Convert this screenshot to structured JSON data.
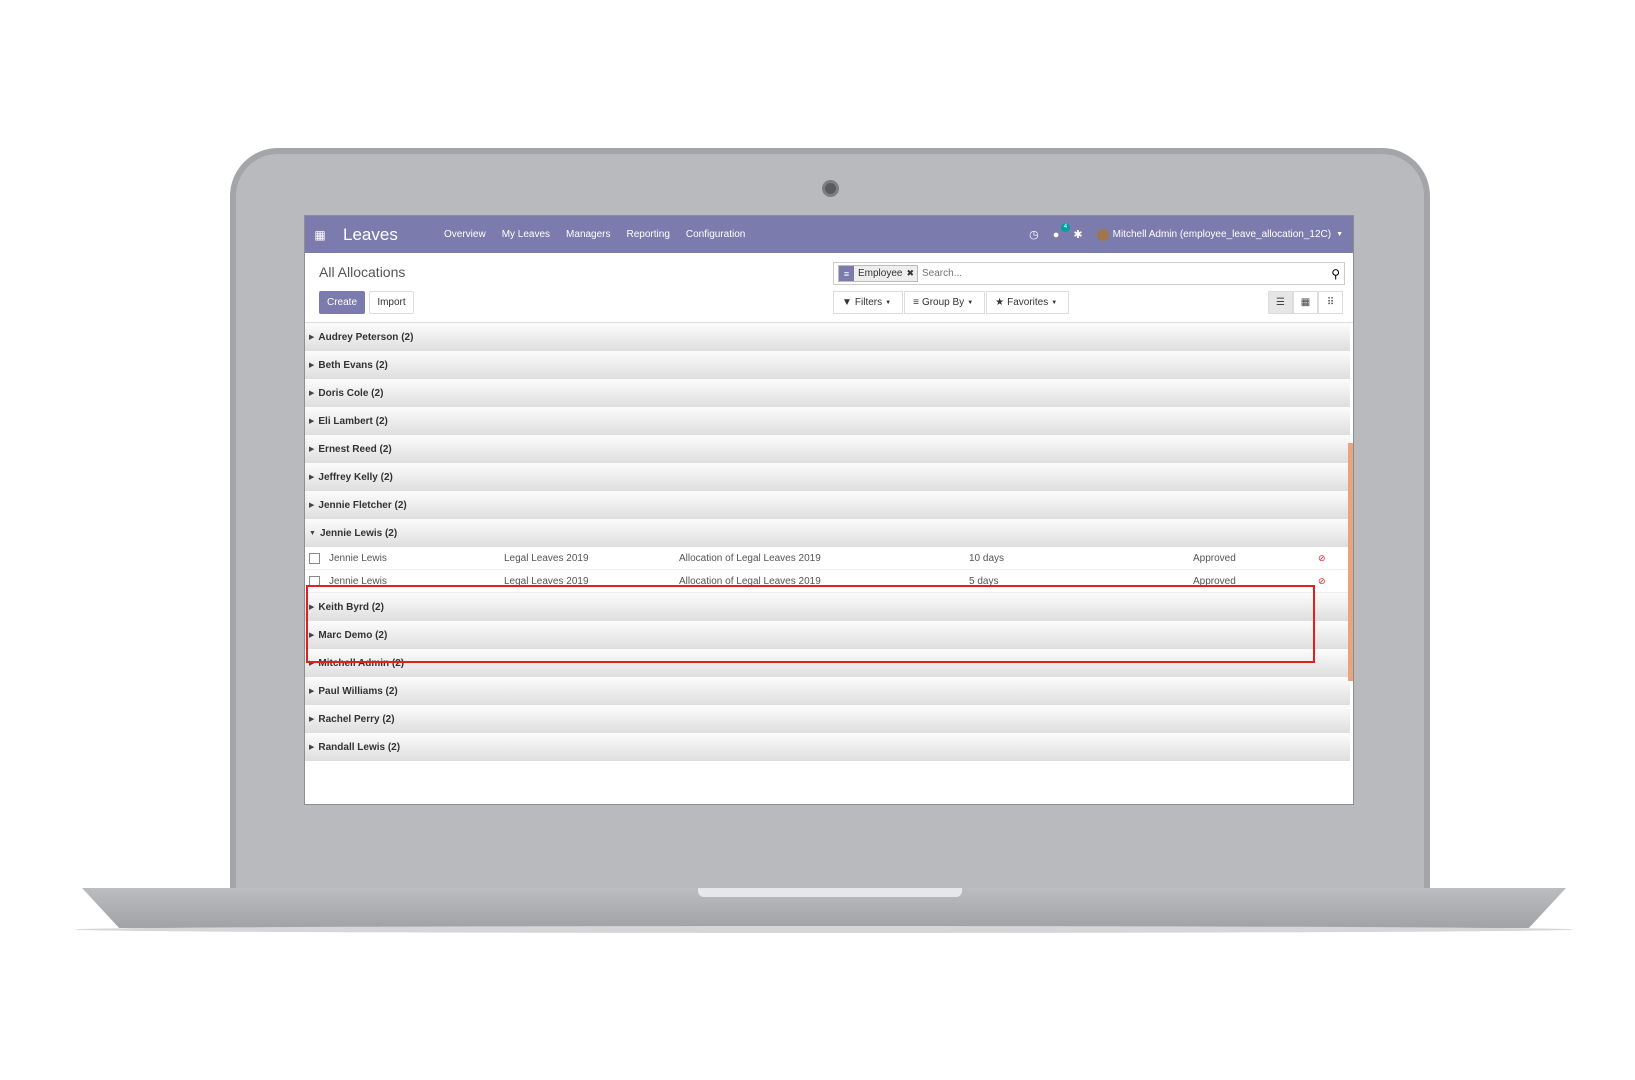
{
  "navbar": {
    "app_name": "Leaves",
    "menu": [
      "Overview",
      "My Leaves",
      "Managers",
      "Reporting",
      "Configuration"
    ],
    "messages_badge": "4",
    "user": "Mitchell Admin (employee_leave_allocation_12C)"
  },
  "control_panel": {
    "title": "All Allocations",
    "create_label": "Create",
    "import_label": "Import",
    "search": {
      "facet_value": "Employee",
      "placeholder": "Search..."
    },
    "filters_label": "Filters",
    "group_by_label": "Group By",
    "favorites_label": "Favorites"
  },
  "groups": [
    {
      "label": "Audrey Peterson (2)"
    },
    {
      "label": "Beth Evans (2)"
    },
    {
      "label": "Doris Cole (2)"
    },
    {
      "label": "Eli Lambert (2)"
    },
    {
      "label": "Ernest Reed (2)"
    },
    {
      "label": "Jeffrey Kelly (2)"
    },
    {
      "label": "Jennie Fletcher (2)"
    },
    {
      "label": "Jennie Lewis (2)"
    },
    {
      "label": "Keith Byrd (2)"
    },
    {
      "label": "Marc Demo (2)"
    },
    {
      "label": "Mitchell Admin (2)"
    },
    {
      "label": "Paul Williams (2)"
    },
    {
      "label": "Rachel Perry (2)"
    },
    {
      "label": "Randall Lewis (2)"
    }
  ],
  "expanded_records": [
    {
      "employee": "Jennie Lewis",
      "leave_type": "Legal Leaves 2019",
      "description": "Allocation of Legal Leaves 2019",
      "duration": "10 days",
      "state": "Approved"
    },
    {
      "employee": "Jennie Lewis",
      "leave_type": "Legal Leaves 2019",
      "description": "Allocation of Legal Leaves 2019",
      "duration": "5 days",
      "state": "Approved"
    }
  ],
  "colors": {
    "primary": "#7c7bad",
    "highlight": "#e02020",
    "badge": "#00a09d"
  }
}
